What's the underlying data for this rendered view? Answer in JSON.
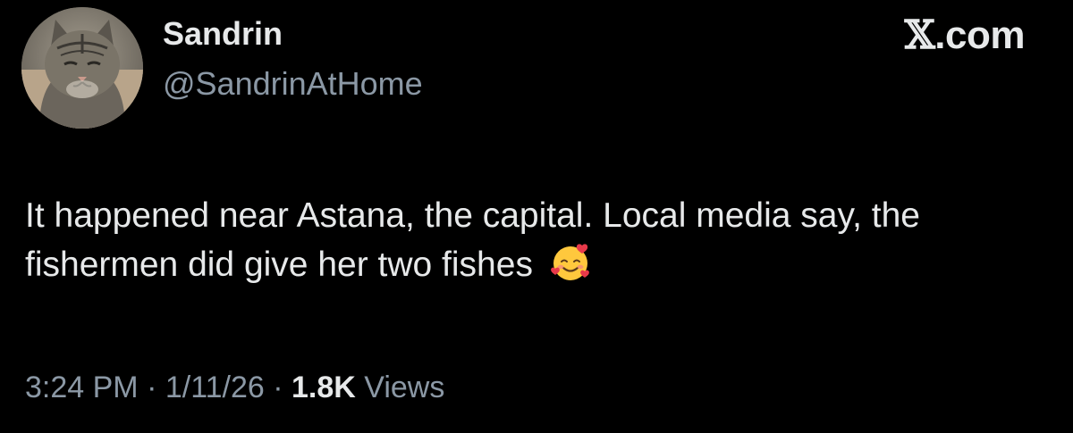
{
  "author": {
    "display_name": "Sandrin",
    "handle": "@SandrinAtHome",
    "avatar_icon": "cat-avatar"
  },
  "brand": {
    "mark": "𝕏",
    "domain": ".com"
  },
  "tweet": {
    "text": "It happened near Astana, the capital. Local media say, the fishermen did give her two fishes",
    "emoji_icon": "smiling-face-with-hearts-icon"
  },
  "meta": {
    "time": "3:24 PM",
    "separator": " · ",
    "date": "1/11/26",
    "views_count": "1.8K",
    "views_label": " Views"
  },
  "colors": {
    "background": "#000000",
    "primary_text": "#e7e9ea",
    "secondary_text": "#8b98a5"
  }
}
